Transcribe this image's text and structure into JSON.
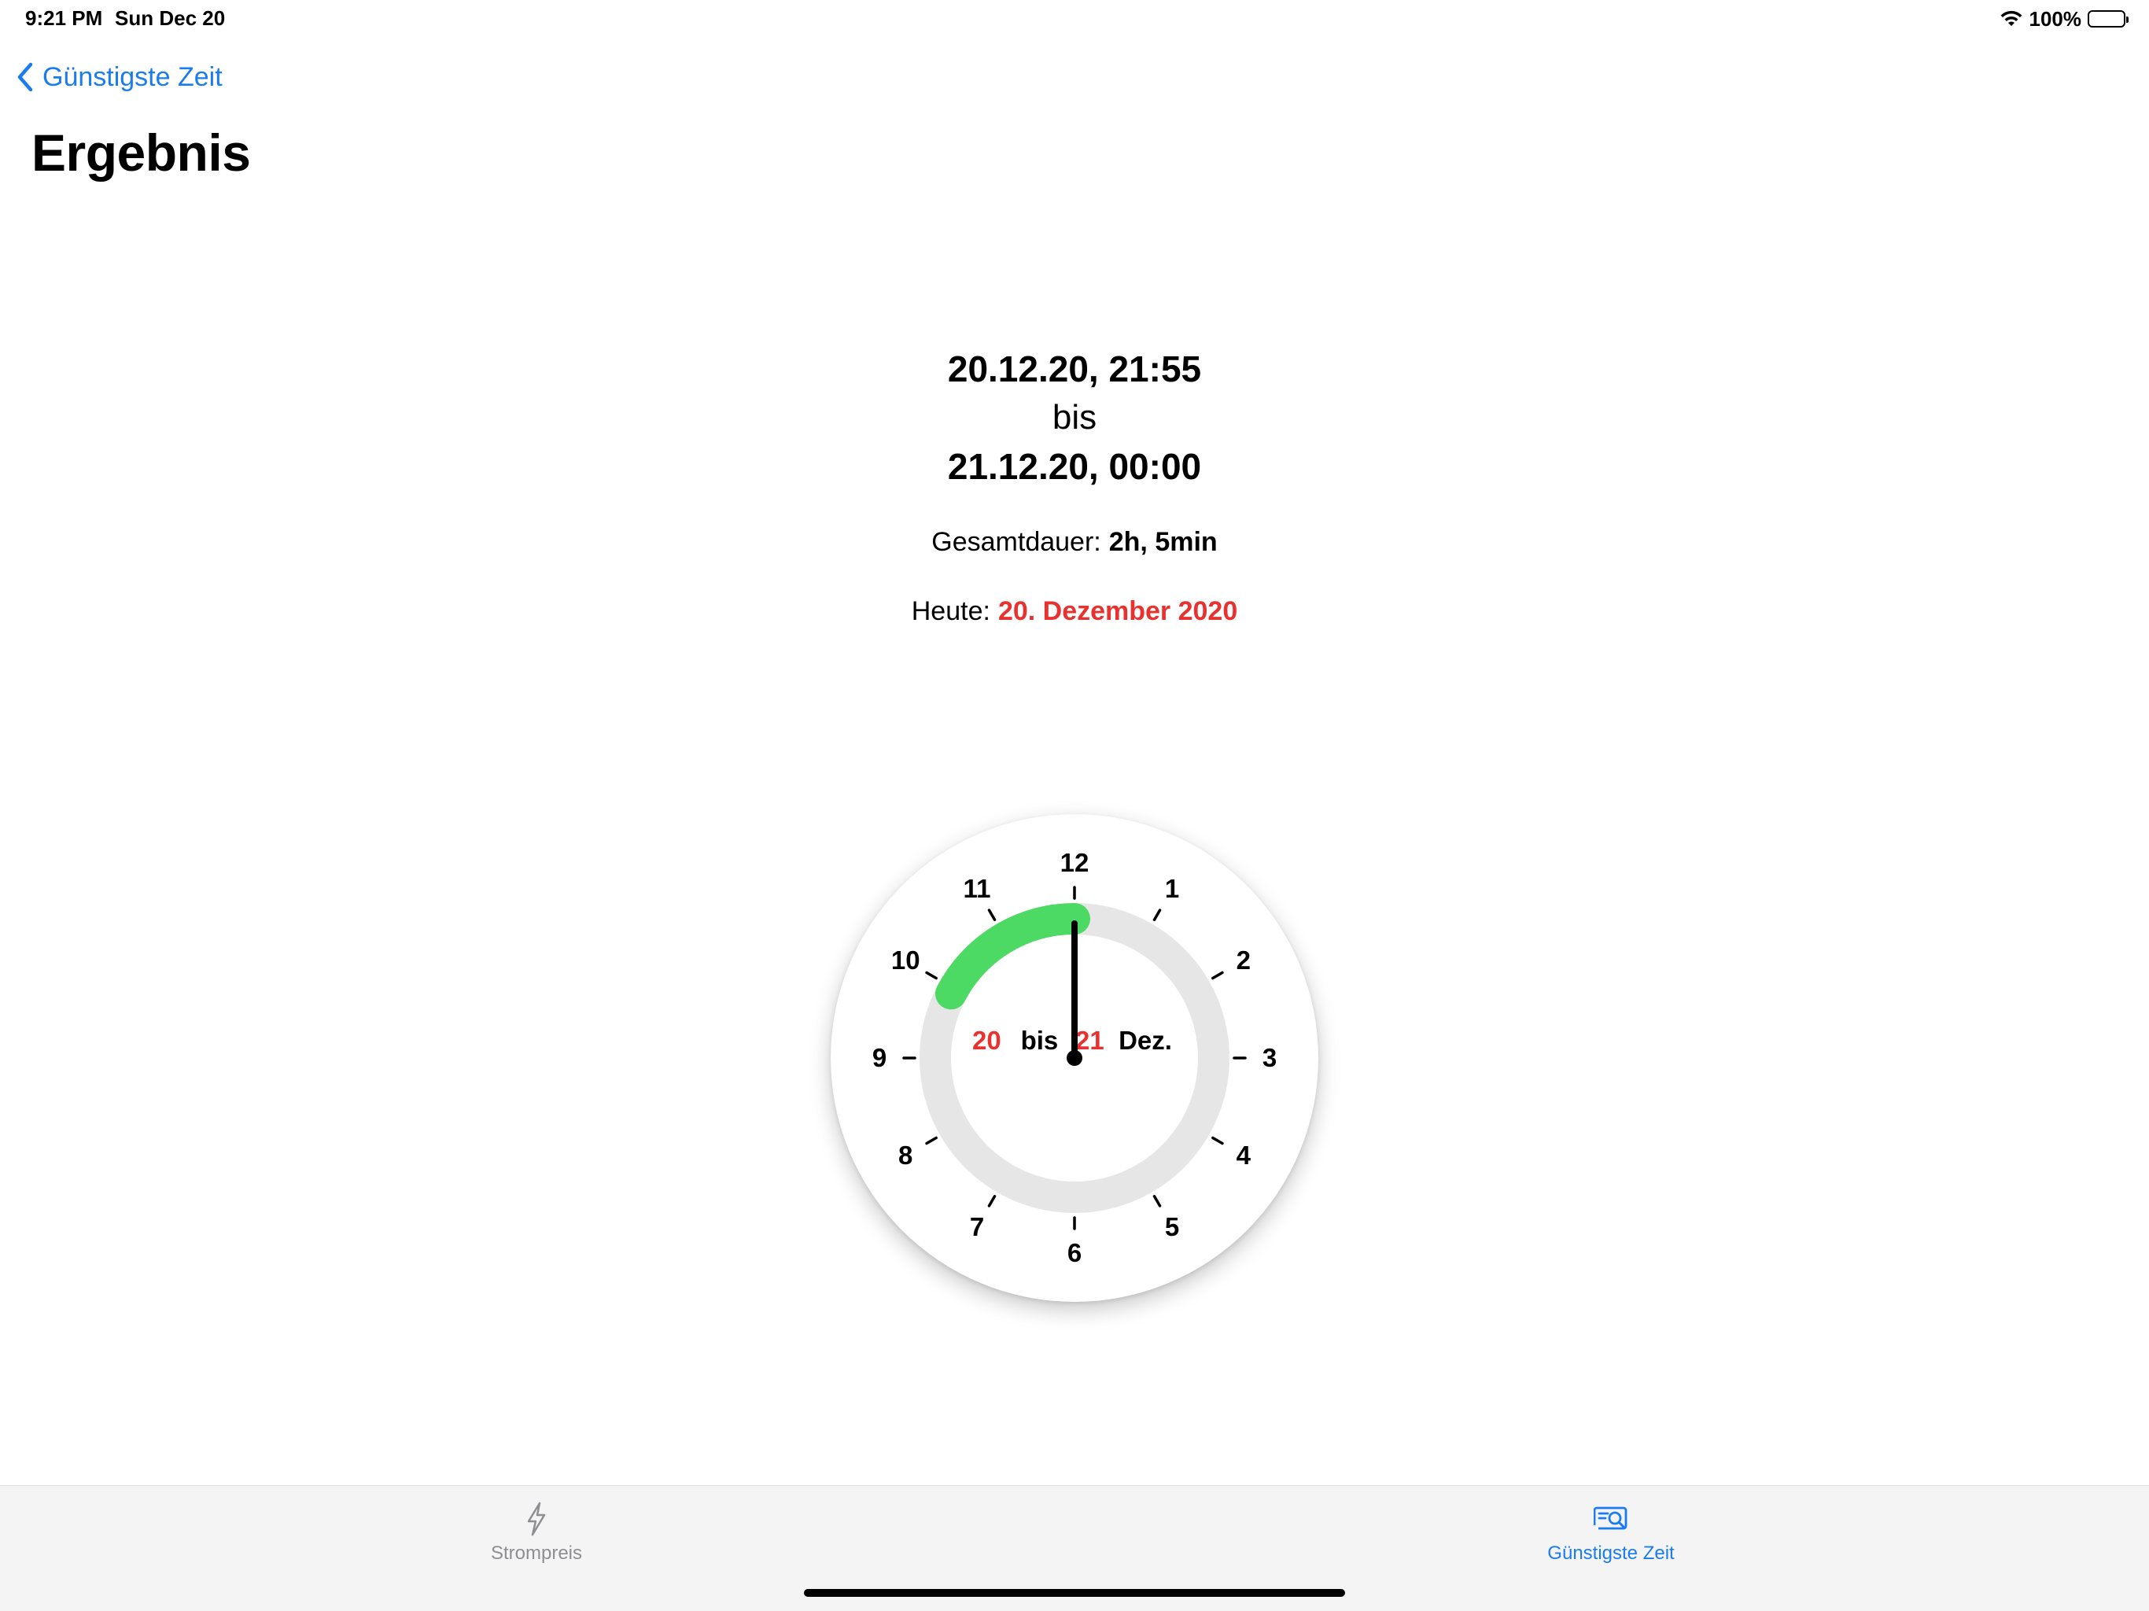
{
  "status_bar": {
    "time": "9:21 PM",
    "date": "Sun Dec 20",
    "battery_percent": "100%",
    "battery_level": 1.0
  },
  "nav": {
    "back_label": "Günstigste Zeit",
    "title": "Ergebnis"
  },
  "result": {
    "start": "20.12.20, 21:55",
    "separator": "bis",
    "end": "21.12.20, 00:00",
    "duration_label": "Gesamtdauer:",
    "duration_value": "2h, 5min",
    "today_label": "Heute:",
    "today_value": "20. Dezember 2020"
  },
  "clock": {
    "hour_labels": [
      "12",
      "1",
      "2",
      "3",
      "4",
      "5",
      "6",
      "7",
      "8",
      "9",
      "10",
      "11"
    ],
    "center_text": {
      "start_day": "20",
      "separator": "bis",
      "end_day": "21",
      "month": "Dez."
    },
    "highlight_start_hour": 21.9167,
    "highlight_end_hour": 24.0,
    "hand_hour": 0,
    "colors": {
      "highlight": "#4cd964",
      "track": "#e6e6e6",
      "day_number": "#e8322f",
      "hand": "#000000"
    }
  },
  "tab_bar": {
    "tabs": [
      {
        "label": "Strompreis",
        "icon": "bolt-icon",
        "selected": false
      },
      {
        "label": "Günstigste Zeit",
        "icon": "search-document-icon",
        "selected": true
      }
    ]
  },
  "colors": {
    "accent": "#1a7cf0",
    "today_red": "#e8322f",
    "tab_inactive": "#8e8e93"
  }
}
